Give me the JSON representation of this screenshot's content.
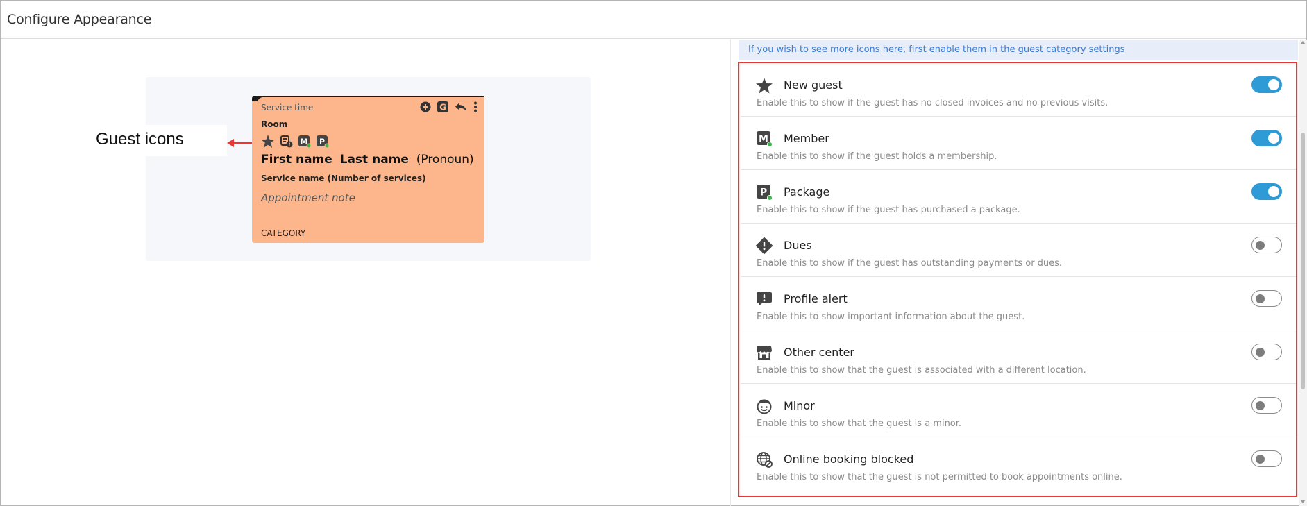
{
  "window": {
    "title": "Configure Appearance"
  },
  "preview": {
    "annotation_label": "Guest icons",
    "card": {
      "service_time": "Service time",
      "room": "Room",
      "first_name": "First name",
      "last_name": "Last name",
      "pronoun": "(Pronoun)",
      "service": "Service name  (Number of services)",
      "note": "Appointment note",
      "category": "CATEGORY",
      "action_icons": [
        "plus-circle-icon",
        "g-badge-icon",
        "reply-icon",
        "more-vertical-icon"
      ],
      "guest_icons": [
        "star-icon",
        "profile-alert-icon",
        "member-icon",
        "package-icon"
      ],
      "background_color": "#fdb58b"
    }
  },
  "panel": {
    "info_text": "If you wish to see more icons here, first enable them in the guest category settings",
    "accent_color": "#2f9bd6",
    "items": [
      {
        "icon": "star-icon",
        "title": "New guest",
        "desc": "Enable this to show if the guest has no closed invoices and no previous visits.",
        "enabled": true
      },
      {
        "icon": "member-icon",
        "title": "Member",
        "desc": "Enable this to show if the guest holds a membership.",
        "enabled": true
      },
      {
        "icon": "package-icon",
        "title": "Package",
        "desc": "Enable this to show if the guest has purchased a package.",
        "enabled": true
      },
      {
        "icon": "dues-icon",
        "title": "Dues",
        "desc": "Enable this to show if the guest has outstanding payments or dues.",
        "enabled": false
      },
      {
        "icon": "profile-alert-icon",
        "title": "Profile alert",
        "desc": "Enable this to show important information about the guest.",
        "enabled": false
      },
      {
        "icon": "store-icon",
        "title": "Other center",
        "desc": "Enable this to show that the guest is associated with a different location.",
        "enabled": false
      },
      {
        "icon": "child-face-icon",
        "title": "Minor",
        "desc": "Enable this to show that the guest is a minor.",
        "enabled": false
      },
      {
        "icon": "globe-blocked-icon",
        "title": "Online booking blocked",
        "desc": "Enable this to show that the guest is not permitted to book appointments online.",
        "enabled": false
      }
    ]
  }
}
